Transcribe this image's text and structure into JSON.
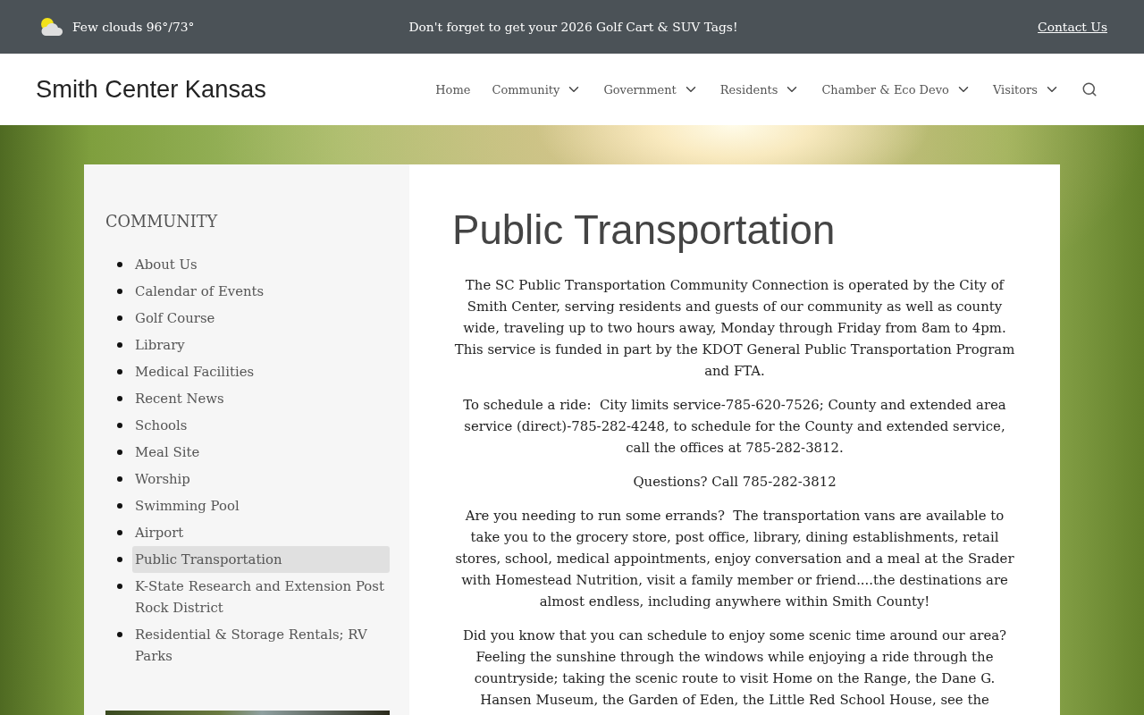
{
  "top_bar": {
    "weather": "Few clouds 96°/73°",
    "announcement": "Don't forget to get your 2026 Golf Cart & SUV Tags!",
    "contact_link": "Contact Us"
  },
  "header": {
    "site_title": "Smith Center Kansas",
    "nav": [
      {
        "label": "Home",
        "has_menu": false
      },
      {
        "label": "Community",
        "has_menu": true
      },
      {
        "label": "Government",
        "has_menu": true
      },
      {
        "label": "Residents",
        "has_menu": true
      },
      {
        "label": "Chamber & Eco Devo",
        "has_menu": true
      },
      {
        "label": "Visitors",
        "has_menu": true
      }
    ]
  },
  "sidebar": {
    "heading": "COMMUNITY",
    "items": [
      {
        "label": "About Us",
        "selected": false
      },
      {
        "label": "Calendar of Events",
        "selected": false
      },
      {
        "label": "Golf Course",
        "selected": false
      },
      {
        "label": "Library",
        "selected": false
      },
      {
        "label": "Medical Facilities",
        "selected": false
      },
      {
        "label": "Recent News",
        "selected": false
      },
      {
        "label": "Schools",
        "selected": false
      },
      {
        "label": "Meal Site",
        "selected": false
      },
      {
        "label": "Worship",
        "selected": false
      },
      {
        "label": "Swimming Pool",
        "selected": false
      },
      {
        "label": "Airport",
        "selected": false
      },
      {
        "label": "Public Transportation",
        "selected": true
      },
      {
        "label": "K-State Research and Extension Post Rock District",
        "selected": false
      },
      {
        "label": "Residential & Storage Rentals; RV Parks",
        "selected": false
      }
    ]
  },
  "content": {
    "title": "Public Transportation",
    "paragraphs": [
      "The SC Public Transportation Community Connection is operated by the City of Smith Center, serving residents and guests of our community as well as county wide, traveling up to two hours away, Monday through Friday from 8am to 4pm. This service is funded in part by the KDOT General Public Transportation Program and FTA.",
      "To schedule a ride:  City limits service-785-620-7526; County and extended area service (direct)-785-282-4248, to schedule for the County and extended service, call the offices at 785-282-3812.",
      "Questions? Call 785-282-3812",
      "Are you needing to run some errands?  The transportation vans are available to take you to the grocery store, post office, library, dining establishments, retail stores, school, medical appointments, enjoy conversation and a meal at the Srader with Homestead Nutrition, visit a family member or friend....the destinations are almost endless, including anywhere within Smith County!",
      "Did you know that you can schedule to enjoy some scenic time around our area? Feeling the sunshine through the windows while enjoying a ride through the countryside; taking the scenic route to visit Home on the Range, the Dane G. Hansen Museum, the Garden of Eden, the Little Red School House, see the"
    ]
  }
}
